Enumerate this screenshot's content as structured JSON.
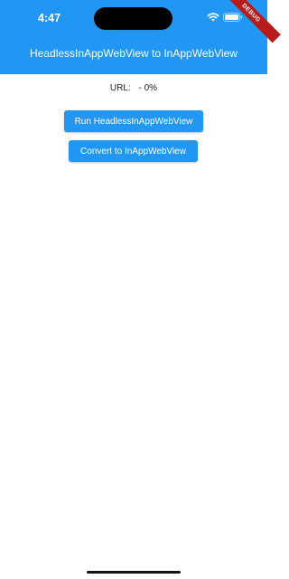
{
  "status_bar": {
    "time": "4:47",
    "wifi_icon": "wifi-icon",
    "battery_icon": "battery-icon"
  },
  "debug_banner": "DEBUG",
  "appbar": {
    "title": "HeadlessInAppWebView to InAppWebView",
    "color": "#2196f3"
  },
  "url": {
    "label": "URL:",
    "value": "- 0%"
  },
  "buttons": {
    "run_label": "Run HeadlessInAppWebView",
    "convert_label": "Convert to InAppWebView"
  }
}
